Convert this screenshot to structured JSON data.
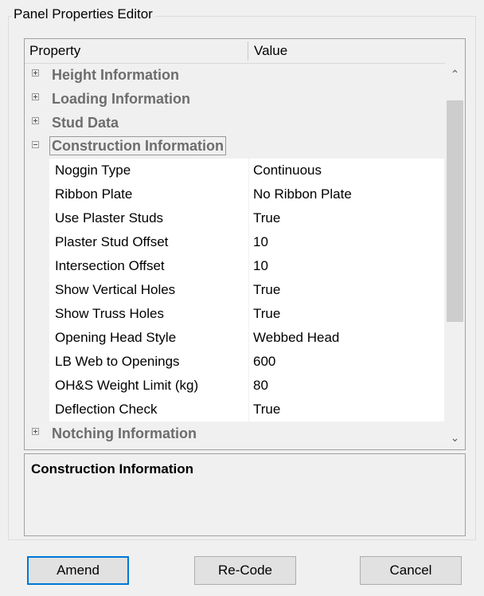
{
  "group_title": "Panel Properties Editor",
  "grid": {
    "header": {
      "property": "Property",
      "value": "Value"
    },
    "categories": {
      "height": "Height Information",
      "loading": "Loading Information",
      "stud": "Stud Data",
      "construction": "Construction Information",
      "notching": "Notching Information"
    },
    "properties": [
      {
        "name": "Noggin Type",
        "value": "Continuous"
      },
      {
        "name": "Ribbon Plate",
        "value": "No Ribbon Plate"
      },
      {
        "name": "Use Plaster Studs",
        "value": "True"
      },
      {
        "name": "Plaster Stud Offset",
        "value": "10"
      },
      {
        "name": "Intersection Offset",
        "value": "10"
      },
      {
        "name": "Show Vertical Holes",
        "value": "True"
      },
      {
        "name": "Show Truss Holes",
        "value": "True"
      },
      {
        "name": "Opening Head Style",
        "value": "Webbed Head"
      },
      {
        "name": "LB Web to Openings",
        "value": "600"
      },
      {
        "name": "OH&S Weight Limit (kg)",
        "value": "80"
      },
      {
        "name": "Deflection Check",
        "value": "True"
      }
    ]
  },
  "description": {
    "title": "Construction Information"
  },
  "buttons": {
    "amend": "Amend",
    "recode": "Re-Code",
    "cancel": "Cancel"
  },
  "colors": {
    "default_button_border": "#0078d7",
    "category_text": "#6d6d6d"
  }
}
